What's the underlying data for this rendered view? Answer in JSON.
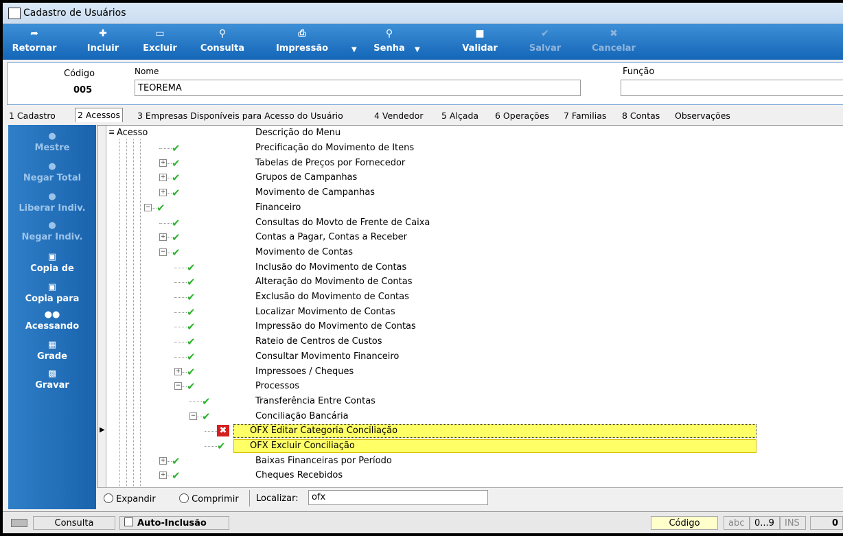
{
  "window": {
    "title": "Cadastro de Usuários"
  },
  "toolbar": {
    "buttons": [
      {
        "label": "Retornar",
        "icon": "back-arrow-icon",
        "enabled": true
      },
      {
        "label": "Incluir",
        "icon": "add-icon",
        "enabled": true
      },
      {
        "label": "Excluir",
        "icon": "trash-icon",
        "enabled": true
      },
      {
        "label": "Consulta",
        "icon": "magnifier-icon",
        "enabled": true
      },
      {
        "label": "Impressão",
        "icon": "printer-icon",
        "enabled": true
      },
      {
        "label": "Senha",
        "icon": "key-icon",
        "enabled": true
      },
      {
        "label": "Validar",
        "icon": "validate-icon",
        "enabled": true
      },
      {
        "label": "Salvar",
        "icon": "check-icon",
        "enabled": false
      },
      {
        "label": "Cancelar",
        "icon": "cancel-icon",
        "enabled": false
      }
    ]
  },
  "form": {
    "codigo_label": "Código",
    "codigo_value": "005",
    "nome_label": "Nome",
    "nome_value": "TEOREMA",
    "funcao_label": "Função",
    "funcao_value": ""
  },
  "tabs": [
    {
      "label": "1 Cadastro"
    },
    {
      "label": "2 Acessos",
      "active": true
    },
    {
      "label": "3 Empresas Disponíveis para Acesso do Usuário"
    },
    {
      "label": "4 Vendedor"
    },
    {
      "label": "5 Alçada"
    },
    {
      "label": "6 Operações"
    },
    {
      "label": "7 Familias"
    },
    {
      "label": "8 Contas"
    },
    {
      "label": "Observações"
    }
  ],
  "sidebar": {
    "items": [
      {
        "label": "Mestre",
        "icon": "user-icon",
        "enabled": false
      },
      {
        "label": "Negar Total",
        "icon": "user-deny-icon",
        "enabled": false
      },
      {
        "label": "Liberar Indiv.",
        "icon": "user-allow-icon",
        "enabled": false
      },
      {
        "label": "Negar Indiv.",
        "icon": "user-remove-icon",
        "enabled": false
      },
      {
        "label": "Copia de",
        "icon": "copy-from-icon",
        "enabled": true
      },
      {
        "label": "Copia para",
        "icon": "copy-to-icon",
        "enabled": true
      },
      {
        "label": "Acessando",
        "icon": "users-icon",
        "enabled": true
      },
      {
        "label": "Grade",
        "icon": "grid-icon",
        "enabled": true
      },
      {
        "label": "Gravar",
        "icon": "save-icon",
        "enabled": true
      }
    ]
  },
  "grid": {
    "col_acesso": "Acesso",
    "col_descricao": "Descrição do Menu",
    "rows": [
      {
        "text": "Precificação do Movimento de Itens",
        "level": 3,
        "expander": "none",
        "status": "allowed"
      },
      {
        "text": "Tabelas de Preços por Fornecedor",
        "level": 3,
        "expander": "plus",
        "status": "allowed"
      },
      {
        "text": "Grupos de Campanhas",
        "level": 3,
        "expander": "plus",
        "status": "allowed"
      },
      {
        "text": "Movimento de Campanhas",
        "level": 3,
        "expander": "plus",
        "status": "allowed"
      },
      {
        "text": "Financeiro",
        "level": 2,
        "expander": "minus",
        "status": "allowed"
      },
      {
        "text": "Consultas do Movto de Frente de Caixa",
        "level": 3,
        "expander": "none",
        "status": "allowed"
      },
      {
        "text": "Contas a Pagar, Contas a Receber",
        "level": 3,
        "expander": "plus",
        "status": "allowed"
      },
      {
        "text": "Movimento de Contas",
        "level": 3,
        "expander": "minus",
        "status": "allowed"
      },
      {
        "text": "Inclusão do Movimento de Contas",
        "level": 4,
        "expander": "none",
        "status": "allowed"
      },
      {
        "text": "Alteração do Movimento de Contas",
        "level": 4,
        "expander": "none",
        "status": "allowed"
      },
      {
        "text": "Exclusão do Movimento de Contas",
        "level": 4,
        "expander": "none",
        "status": "allowed"
      },
      {
        "text": "Localizar Movimento de Contas",
        "level": 4,
        "expander": "none",
        "status": "allowed"
      },
      {
        "text": "Impressão do Movimento de Contas",
        "level": 4,
        "expander": "none",
        "status": "allowed"
      },
      {
        "text": "Rateio de Centros de Custos",
        "level": 4,
        "expander": "none",
        "status": "allowed"
      },
      {
        "text": "Consultar Movimento Financeiro",
        "level": 4,
        "expander": "none",
        "status": "allowed"
      },
      {
        "text": "Impressoes / Cheques",
        "level": 4,
        "expander": "plus",
        "status": "allowed"
      },
      {
        "text": "Processos",
        "level": 4,
        "expander": "minus",
        "status": "allowed"
      },
      {
        "text": "Transferência Entre Contas",
        "level": 5,
        "expander": "none",
        "status": "allowed"
      },
      {
        "text": "Conciliação Bancária",
        "level": 5,
        "expander": "minus",
        "status": "allowed"
      },
      {
        "text": "OFX Editar Categoria Conciliação",
        "level": 6,
        "expander": "none",
        "status": "denied",
        "highlight": true,
        "current": true
      },
      {
        "text": "OFX Excluir Conciliação",
        "level": 6,
        "expander": "none",
        "status": "allowed",
        "highlight": true
      },
      {
        "text": "Baixas Financeiras por Período",
        "level": 3,
        "expander": "plus",
        "status": "allowed"
      },
      {
        "text": "Cheques Recebidos",
        "level": 3,
        "expander": "plus",
        "status": "allowed"
      }
    ]
  },
  "bottom": {
    "expandir": "Expandir",
    "comprimir": "Comprimir",
    "localizar_label": "Localizar:",
    "localizar_value": "ofx"
  },
  "status": {
    "mode": "Consulta",
    "auto_inclusao": "Auto-Inclusão",
    "field": "Código",
    "abc": "abc",
    "num": "0...9",
    "ins": "INS",
    "count": "0"
  },
  "colors": {
    "accent": "#1466b8",
    "check": "#2cb42c",
    "deny": "#d42020",
    "highlight": "#ffff66"
  }
}
